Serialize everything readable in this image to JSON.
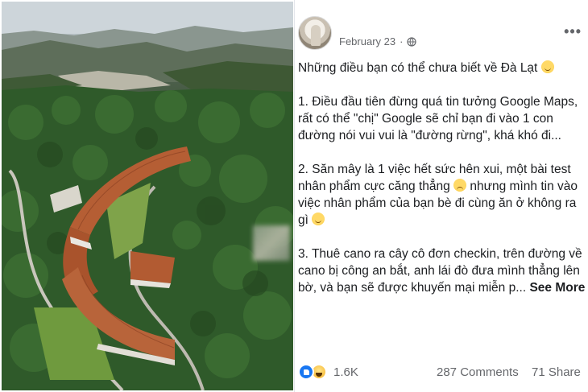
{
  "post": {
    "date": "February 23",
    "more_label": "•••",
    "paragraphs": {
      "p0": "Những điều bạn có thể chưa biết về Đà Lạt",
      "p1": "1. Điều đầu tiên đừng quá tin tưởng Google Maps, rất có thể \"chị\" Google sẽ chỉ bạn đi vào 1 con đường nói vui vui là \"đường rừng\", khá khó đi...",
      "p2a": "2. Săn mây là 1 việc hết sức hên xui, một bài test nhân phẩm cực căng thẳng",
      "p2b": "nhưng mình tin vào việc nhân phẩm của bạn bè đi cùng ăn ở không ra gì",
      "p3": "3. Thuê cano ra cây cô đơn checkin, trên đường về cano bị công an bắt, anh lái đò đưa mình thẳng lên bờ, và bạn sẽ được khuyến mại miễn p..."
    },
    "see_more": "See More",
    "reactions_count": "1.6K",
    "comments": "287 Comments",
    "shares": "71 Share"
  },
  "icons": {
    "globe": "globe-icon",
    "like": "like-reaction-icon",
    "haha": "haha-reaction-icon",
    "emoji_smile": "smile-emoji",
    "emoji_sad": "sad-emoji"
  },
  "colors": {
    "text": "#1c1e21",
    "muted": "#65676b",
    "like_blue": "#1877f2"
  }
}
